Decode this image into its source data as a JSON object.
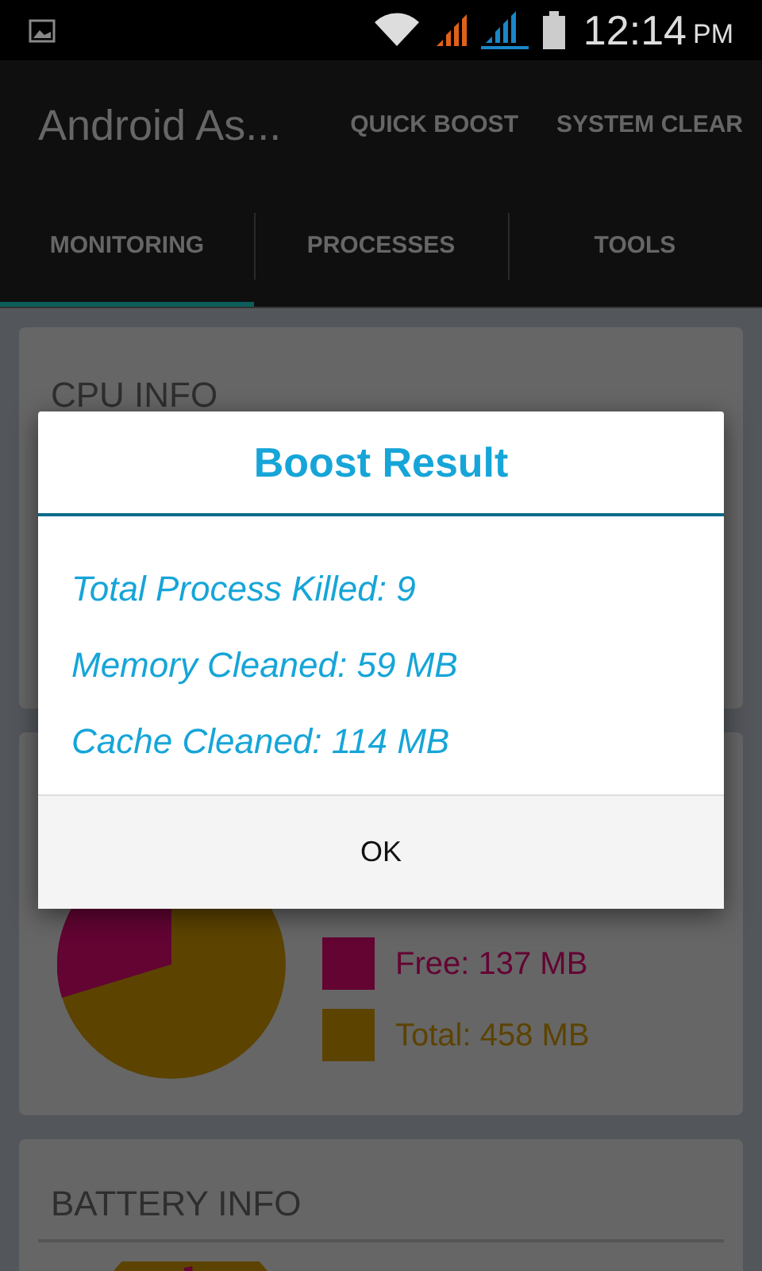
{
  "status_bar": {
    "time": "12:14",
    "ampm": "PM"
  },
  "action_bar": {
    "title": "Android As...",
    "actions": [
      "QUICK BOOST",
      "SYSTEM CLEAR"
    ]
  },
  "tabs": [
    {
      "label": "MONITORING",
      "selected": true
    },
    {
      "label": "PROCESSES",
      "selected": false
    },
    {
      "label": "TOOLS",
      "selected": false
    }
  ],
  "cpu_card": {
    "title": "CPU INFO"
  },
  "memory_card": {
    "legend": [
      {
        "label": "Free: 137 MB",
        "color": "#630433"
      },
      {
        "label": "Total: 458 MB",
        "color": "#5c4300"
      }
    ]
  },
  "battery_card": {
    "title": "BATTERY INFO"
  },
  "dialog": {
    "title": "Boost Result",
    "lines": [
      "Total Process Killed: 9",
      "Memory Cleaned: 59 MB",
      "Cache Cleaned: 114 MB"
    ],
    "button": "OK"
  }
}
